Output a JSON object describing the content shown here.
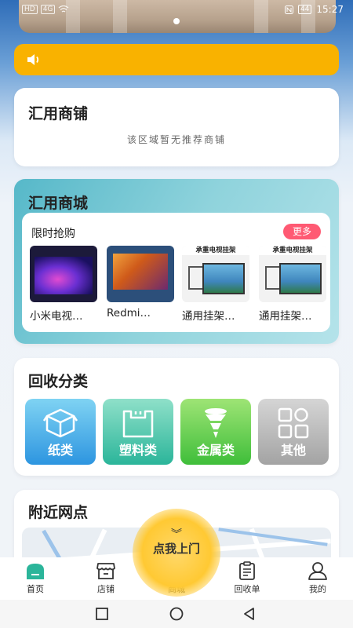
{
  "status_bar": {
    "left_indicators": [
      "HD",
      "4G"
    ],
    "battery": "44",
    "time": "15:27"
  },
  "notice": {
    "icon": "speaker-icon",
    "text": ""
  },
  "shop_section": {
    "title": "汇用商铺",
    "empty_text": "该区域暂无推荐商铺"
  },
  "mall_section": {
    "title": "汇用商城",
    "flash_sale_title": "限时抢购",
    "more_label": "更多",
    "products": [
      {
        "name": "小米电视…",
        "thumb": "tv-oled"
      },
      {
        "name": "Redmi…",
        "thumb": "tv-redmi"
      },
      {
        "name": "通用挂架…",
        "thumb": "mount",
        "thumb_heading": "承重电视挂架"
      },
      {
        "name": "通用挂架…",
        "thumb": "mount",
        "thumb_heading": "承重电视挂架"
      }
    ]
  },
  "recycle_section": {
    "title": "回收分类",
    "categories": [
      {
        "label": "纸类",
        "icon": "box-icon"
      },
      {
        "label": "塑料类",
        "icon": "plastic-bag-icon"
      },
      {
        "label": "金属类",
        "icon": "metal-cone-icon"
      },
      {
        "label": "其他",
        "icon": "grid-icon"
      }
    ]
  },
  "nearby_section": {
    "title": "附近网点",
    "call_button": "点我上门"
  },
  "tabbar": {
    "tabs": [
      {
        "label": "首页",
        "icon": "home-icon",
        "active": true
      },
      {
        "label": "店铺",
        "icon": "store-icon",
        "active": false
      },
      {
        "label": "商城",
        "icon": "shopping-bag-icon",
        "active": false
      },
      {
        "label": "回收单",
        "icon": "clipboard-icon",
        "active": false
      },
      {
        "label": "我的",
        "icon": "user-icon",
        "active": false
      }
    ]
  },
  "colors": {
    "notice_bg": "#f9b200",
    "more_button": "#ff5a73",
    "active_tab": "#2bb59a"
  }
}
